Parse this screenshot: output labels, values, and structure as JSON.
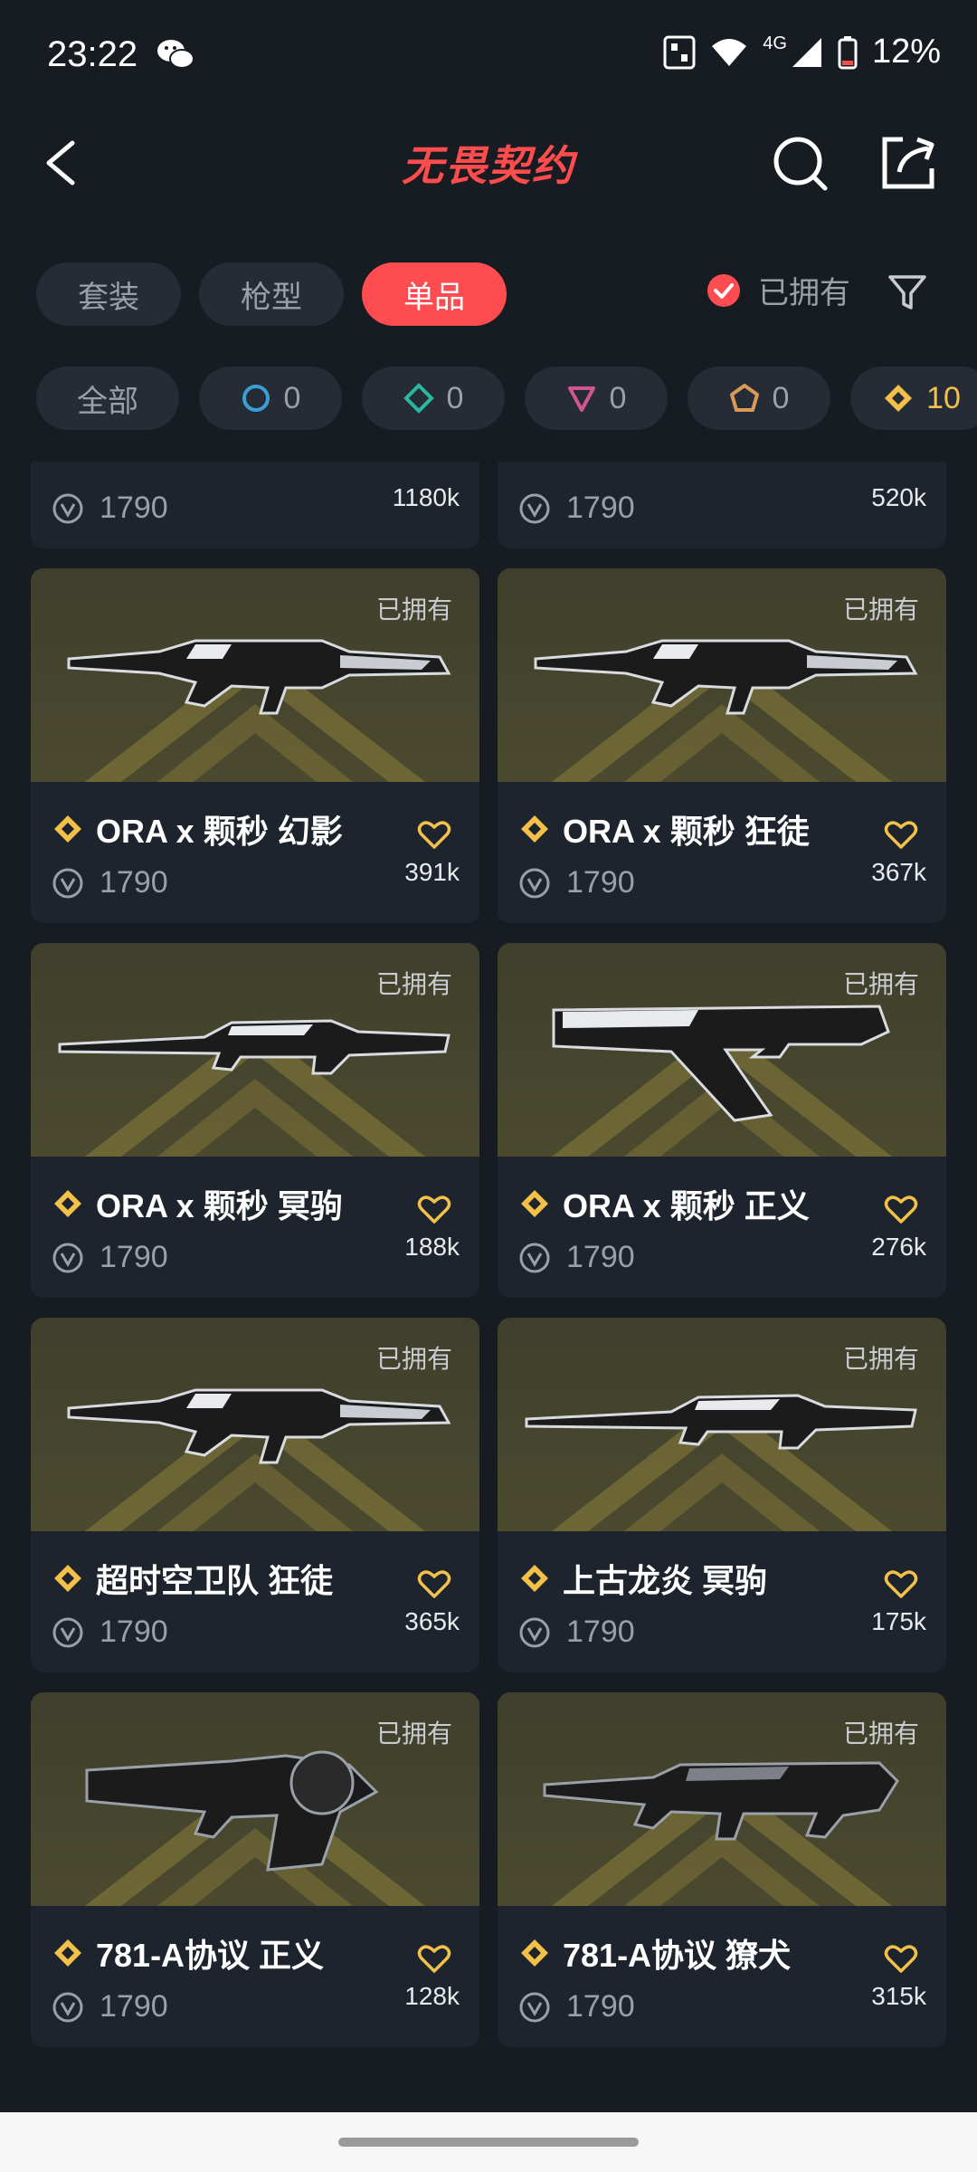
{
  "status_bar": {
    "time": "23:22",
    "network": "4G",
    "battery": "12%"
  },
  "header": {
    "title": "无畏契约"
  },
  "tabs": [
    {
      "label": "套装",
      "active": false
    },
    {
      "label": "枪型",
      "active": false
    },
    {
      "label": "单品",
      "active": true
    }
  ],
  "owned_filter": {
    "label": "已拥有",
    "checked": true
  },
  "rarity_chips": [
    {
      "label": "全部"
    },
    {
      "count": "0",
      "icon": "select-tier-icon",
      "color": "#3b9fd6"
    },
    {
      "count": "0",
      "icon": "deluxe-tier-icon",
      "color": "#2bb8a0"
    },
    {
      "count": "0",
      "icon": "premium-tier-icon",
      "color": "#d2558f"
    },
    {
      "count": "0",
      "icon": "exclusive-tier-icon",
      "color": "#d99a58"
    },
    {
      "count": "10",
      "icon": "ultra-tier-icon",
      "color": "#f3c14a"
    }
  ],
  "partial_row": [
    {
      "price": "1790",
      "likes": "1180k"
    },
    {
      "price": "1790",
      "likes": "520k"
    }
  ],
  "cards": [
    {
      "owned": "已拥有",
      "name": "ORA x 颗秒 幻影",
      "price": "1790",
      "likes": "391k",
      "weapon": "rifle"
    },
    {
      "owned": "已拥有",
      "name": "ORA x 颗秒 狂徒",
      "price": "1790",
      "likes": "367k",
      "weapon": "rifle"
    },
    {
      "owned": "已拥有",
      "name": "ORA x 颗秒 冥驹",
      "price": "1790",
      "likes": "188k",
      "weapon": "sniper"
    },
    {
      "owned": "已拥有",
      "name": "ORA x 颗秒 正义",
      "price": "1790",
      "likes": "276k",
      "weapon": "pistol"
    },
    {
      "owned": "已拥有",
      "name": "超时空卫队 狂徒",
      "price": "1790",
      "likes": "365k",
      "weapon": "rifle"
    },
    {
      "owned": "已拥有",
      "name": "上古龙炎 冥驹",
      "price": "1790",
      "likes": "175k",
      "weapon": "sniper"
    },
    {
      "owned": "已拥有",
      "name": "781-A协议 正义",
      "price": "1790",
      "likes": "128k",
      "weapon": "revolver"
    },
    {
      "owned": "已拥有",
      "name": "781-A协议 獠犬",
      "price": "1790",
      "likes": "315k",
      "weapon": "smg"
    }
  ],
  "colors": {
    "accent": "#ff4c50",
    "tier_gold": "#f3c14a",
    "card_bg": "#1e242d",
    "page_bg": "#171c23"
  }
}
